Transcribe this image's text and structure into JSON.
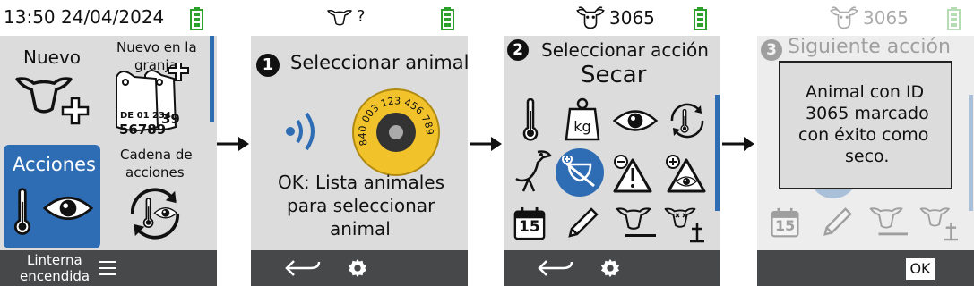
{
  "screen1": {
    "status": {
      "datetime": "13:50 24/04/2024"
    },
    "tiles": [
      {
        "label": "Nuevo"
      },
      {
        "label": "Nuevo en la granja",
        "line1": "Nuevo en la",
        "line2": "granja",
        "tag_left_top": "DE 01 234",
        "tag_left_num": "56789",
        "tag_right_num": "39"
      },
      {
        "label": "Acciones",
        "selected": true
      },
      {
        "label": "Cadena de acciones",
        "line1": "Cadena de",
        "line2": "acciones"
      }
    ],
    "footer": {
      "line1": "Linterna",
      "line2": "encendida",
      "menu_icon": "hamburger-icon"
    }
  },
  "screen2": {
    "status": {
      "animal": "?"
    },
    "step": "1",
    "title": "Seleccionar animal",
    "tag_number": "840 003 123 456 789",
    "message": {
      "line1": "OK: Lista animales",
      "line2": "para seleccionar",
      "line3": "animal"
    },
    "footer": {
      "back_icon": "back-arrow-icon",
      "settings_icon": "gear-icon"
    }
  },
  "screen3": {
    "status": {
      "animal_id": "3065"
    },
    "step": "2",
    "title": "Seleccionar acción",
    "selected_action": "Secar",
    "weight_label": "kg",
    "calendar_day": "15",
    "actions": [
      "thermometer-icon",
      "weight-icon",
      "eye-icon",
      "repeat-thermometer-icon",
      "stork-icon",
      "dry-cow-icon",
      "add-warning-icon",
      "add-eye-warning-icon",
      "calendar-icon",
      "pencil-icon",
      "cow-minus-icon",
      "cow-dead-icon"
    ],
    "footer": {
      "back_icon": "back-arrow-icon",
      "settings_icon": "gear-icon"
    }
  },
  "screen4": {
    "status": {
      "animal_id": "3065"
    },
    "step": "3",
    "title": "Siguiente acción",
    "calendar_day": "15",
    "dialog": {
      "line1": "Animal con ID",
      "line2": "3065 marcado",
      "line3": "con éxito como",
      "line4": "seco."
    },
    "footer": {
      "ok_label": "OK"
    }
  },
  "colors": {
    "accent": "#2e6db4",
    "battery": "#2ba12b",
    "footer": "#47484a",
    "panel": "#dcdcdc",
    "tag_yellow": "#f2c22a"
  }
}
